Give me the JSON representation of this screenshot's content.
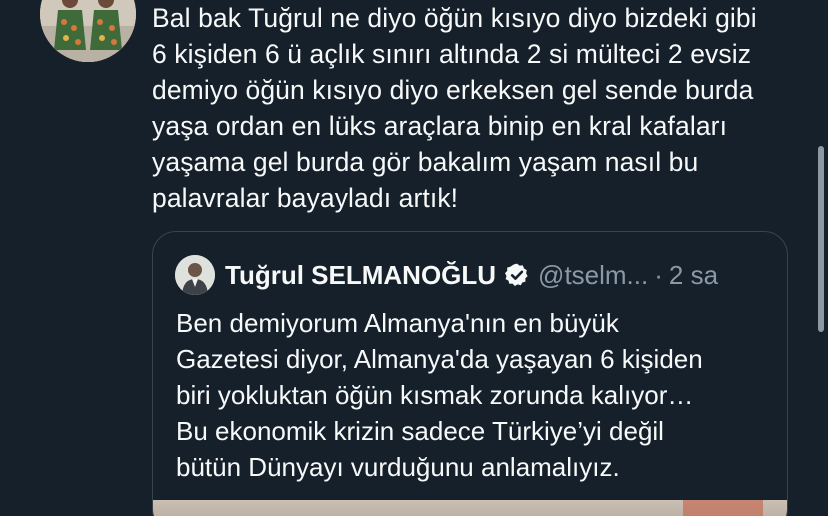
{
  "tweet": {
    "text_lines": [
      "Bal bak Tuğrul ne diyo öğün kısıyo diyo bizdeki gibi",
      "6 kişiden 6 ü açlık sınırı altında 2 si mülteci 2 evsiz",
      "demiyo öğün kısıyo diyo erkeksen gel sende burda",
      "yaşa ordan en lüks araçlara binip en kral kafaları",
      "yaşama gel burda gör bakalım yaşam nasıl bu",
      "palavralar bayayladı artık!"
    ],
    "avatar_icon": "profile-photo"
  },
  "quote": {
    "name": "Tuğrul SELMANOĞLU",
    "verified_icon": "verified-badge-icon",
    "handle": "@tselm...",
    "separator": "·",
    "time": "2 sa",
    "text_lines": [
      "Ben demiyorum Almanya'nın en büyük",
      "Gazetesi diyor, Almanya'da yaşayan 6 kişiden",
      "biri yokluktan öğün kısmak zorunda kalıyor…",
      "Bu ekonomik krizin sadece Türkiye’yi değil",
      "bütün Dünyayı vurduğunu anlamalıyız."
    ]
  },
  "colors": {
    "background": "#15202b",
    "text": "#f7f9f9",
    "secondary_text": "#8b98a5",
    "border": "#38444d"
  }
}
